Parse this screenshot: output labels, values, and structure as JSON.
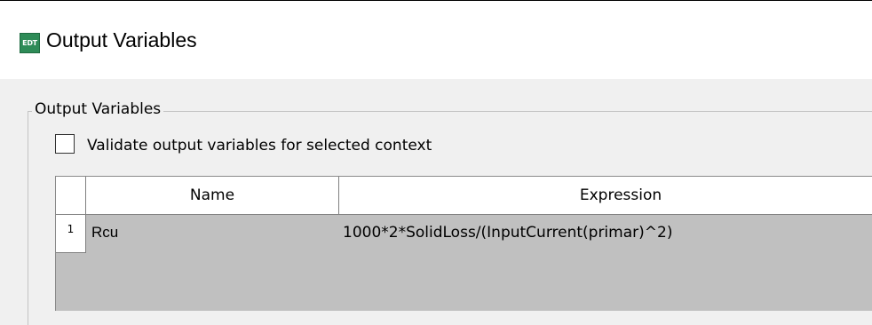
{
  "window": {
    "icon_text": "EDT",
    "title": "Output Variables"
  },
  "group": {
    "label": "Output Variables"
  },
  "validate": {
    "label": "Validate output variables for selected context",
    "checked": false
  },
  "table": {
    "columns": [
      "Name",
      "Expression"
    ],
    "rows": [
      {
        "num": "1",
        "name": "Rcu",
        "expression": "1000*2*SolidLoss/(InputCurrent(primar)^2)"
      }
    ]
  }
}
